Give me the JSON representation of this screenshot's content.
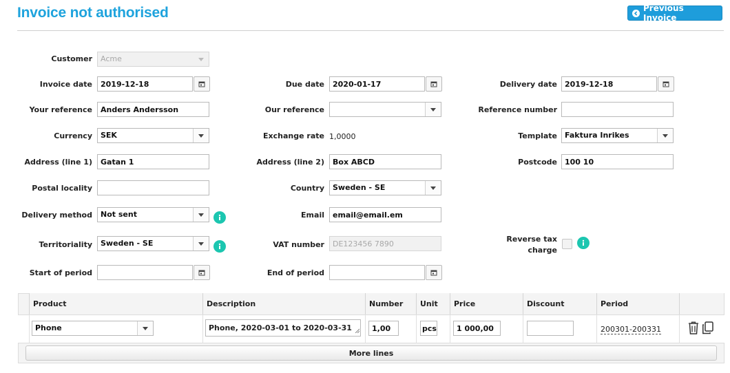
{
  "header": {
    "title": "Invoice not authorised",
    "prev_button": "Previous Invoice",
    "prev_icon": "chevron-left-circle-icon"
  },
  "form": {
    "customer": {
      "label": "Customer",
      "value": "Acme"
    },
    "invoice_date": {
      "label": "Invoice date",
      "value": "2019-12-18"
    },
    "due_date": {
      "label": "Due date",
      "value": "2020-01-17"
    },
    "delivery_date": {
      "label": "Delivery date",
      "value": "2019-12-18"
    },
    "your_reference": {
      "label": "Your reference",
      "value": "Anders Andersson"
    },
    "our_reference": {
      "label": "Our reference",
      "value": ""
    },
    "reference_number": {
      "label": "Reference number",
      "value": ""
    },
    "currency": {
      "label": "Currency",
      "value": "SEK"
    },
    "exchange_rate": {
      "label": "Exchange rate",
      "value": "1,0000"
    },
    "template": {
      "label": "Template",
      "value": "Faktura Inrikes"
    },
    "address1": {
      "label": "Address (line 1)",
      "value": "Gatan 1"
    },
    "address2": {
      "label": "Address (line 2)",
      "value": "Box ABCD"
    },
    "postcode": {
      "label": "Postcode",
      "value": "100 10"
    },
    "postal_locality": {
      "label": "Postal locality",
      "value": ""
    },
    "country": {
      "label": "Country",
      "value": "Sweden - SE"
    },
    "delivery_method": {
      "label": "Delivery method",
      "value": "Not sent"
    },
    "email": {
      "label": "Email",
      "value": "email@email.em"
    },
    "territoriality": {
      "label": "Territoriality",
      "value": "Sweden - SE"
    },
    "vat_number": {
      "label": "VAT number",
      "placeholder": "DE123456 7890"
    },
    "reverse_tax": {
      "label_line1": "Reverse tax",
      "label_line2": "charge",
      "checked": false
    },
    "start_period": {
      "label": "Start of period",
      "value": ""
    },
    "end_period": {
      "label": "End of period",
      "value": ""
    }
  },
  "table": {
    "columns": [
      "Product",
      "Description",
      "Number",
      "Unit",
      "Price",
      "Discount",
      "Period"
    ],
    "rows": [
      {
        "product": "Phone",
        "description": "Phone, 2020-03-01 to 2020-03-31",
        "number": "1,00",
        "unit": "pcs",
        "price": "1 000,00",
        "discount": "",
        "period": "200301-200331"
      }
    ],
    "more_lines": "More lines"
  },
  "colors": {
    "title": "#1ea3dd",
    "button": "#1e9ddb",
    "info": "#1cc6b0"
  }
}
